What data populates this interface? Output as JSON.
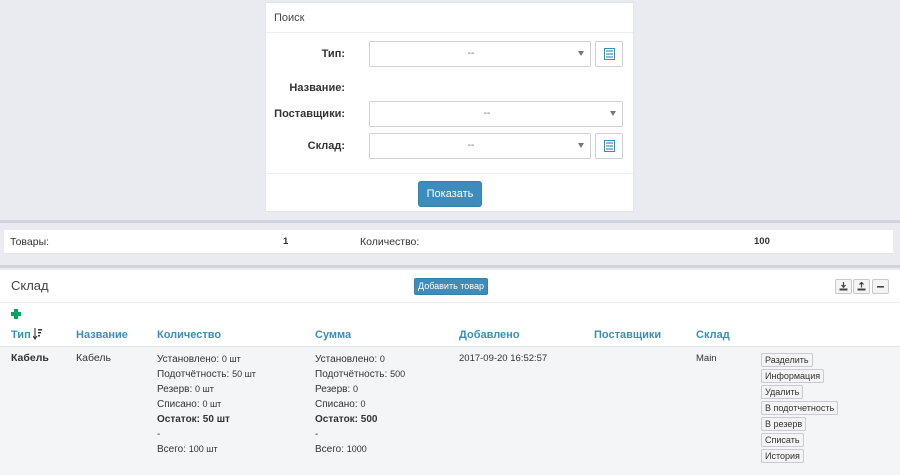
{
  "search": {
    "title": "Поиск",
    "type_label": "Тип:",
    "type_value": "--",
    "name_label": "Название:",
    "suppliers_label": "Поставщики:",
    "suppliers_value": "--",
    "warehouse_label": "Склад:",
    "warehouse_value": "--",
    "show_button": "Показать"
  },
  "summary": {
    "goods_label": "Товары:",
    "goods_value": "1",
    "quantity_label": "Количество:",
    "quantity_value": "100"
  },
  "warehouse": {
    "title": "Склад",
    "add_button": "Добавить товар",
    "columns": {
      "type": "Тип",
      "name": "Название",
      "quantity": "Количество",
      "sum": "Сумма",
      "added": "Добавлено",
      "suppliers": "Поставщики",
      "warehouse": "Склад"
    },
    "row": {
      "type": "Кабель",
      "name": "Кабель",
      "quantity": {
        "installed_label": "Установлено:",
        "installed_value": "0 шт",
        "accountable_label": "Подотчётность:",
        "accountable_value": "50 шт",
        "reserve_label": "Резерв:",
        "reserve_value": "0 шт",
        "written_off_label": "Списано:",
        "written_off_value": "0 шт",
        "remainder": "Остаток: 50 шт",
        "dash": "-",
        "total_label": "Всего:",
        "total_value": "100 шт"
      },
      "sum": {
        "installed_label": "Установлено:",
        "installed_value": "0",
        "accountable_label": "Подотчётность:",
        "accountable_value": "500",
        "reserve_label": "Резерв:",
        "reserve_value": "0",
        "written_off_label": "Списано:",
        "written_off_value": "0",
        "remainder": "Остаток: 500",
        "dash": "-",
        "total_label": "Всего:",
        "total_value": "1000"
      },
      "added": "2017-09-20 16:52:57",
      "suppliers": "",
      "warehouse": "Main",
      "actions": [
        "Разделить",
        "Информация",
        "Удалить",
        "В подотчетность",
        "В резерв",
        "Списать",
        "История"
      ]
    }
  },
  "colors": {
    "accent": "#3c8dbc",
    "add_green": "#00a65a",
    "background": "#e9ebf0"
  },
  "icons": {
    "list": "list-icon",
    "sort": "sort-amount-icon",
    "plus": "plus-icon",
    "import": "import-icon",
    "export": "export-icon",
    "minimize": "minimize-icon"
  }
}
